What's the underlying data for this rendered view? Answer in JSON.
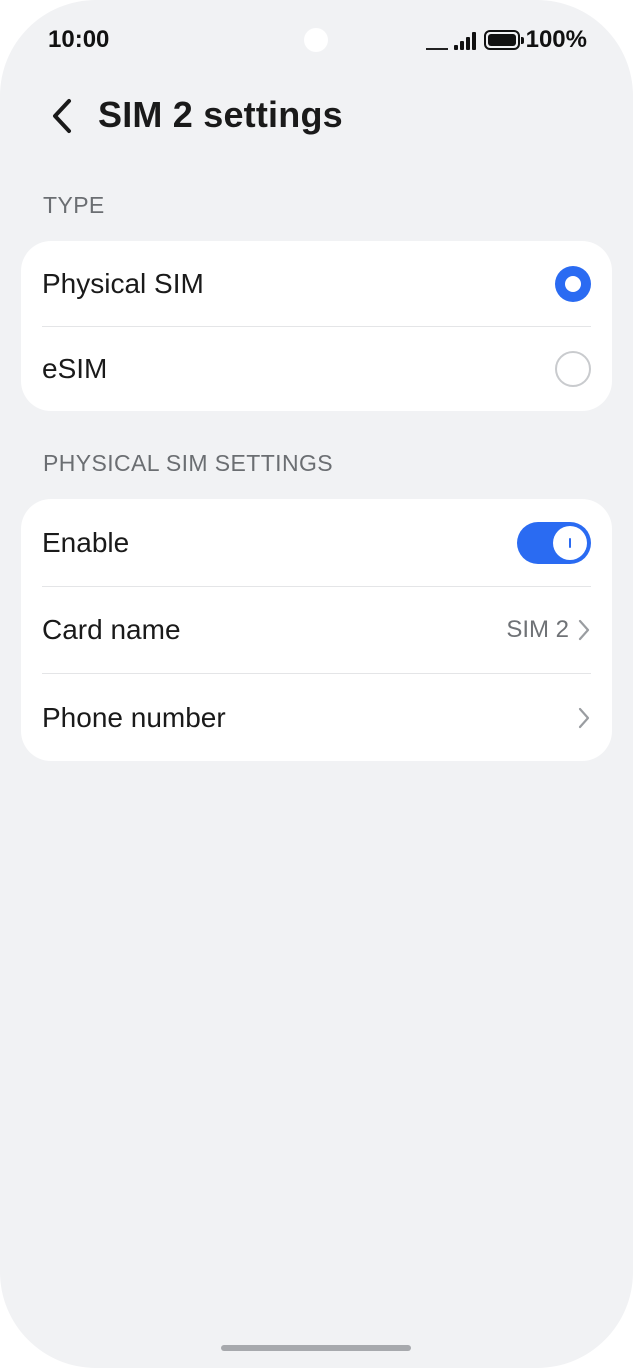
{
  "status_bar": {
    "time": "10:00",
    "battery_percent": "100%",
    "signal_icon": "signal-icon",
    "battery_icon": "battery-icon"
  },
  "header": {
    "title": "SIM 2 settings",
    "back_icon": "back-arrow-icon"
  },
  "type_section": {
    "label": "TYPE",
    "options": [
      {
        "label": "Physical SIM",
        "selected": true
      },
      {
        "label": "eSIM",
        "selected": false
      }
    ]
  },
  "physical_section": {
    "label": "PHYSICAL SIM SETTINGS",
    "enable": {
      "label": "Enable",
      "on": true
    },
    "card_name": {
      "label": "Card name",
      "value": "SIM 2"
    },
    "phone_number": {
      "label": "Phone number"
    }
  },
  "colors": {
    "accent": "#2a6bf2",
    "background": "#f1f2f4",
    "card": "#ffffff"
  }
}
